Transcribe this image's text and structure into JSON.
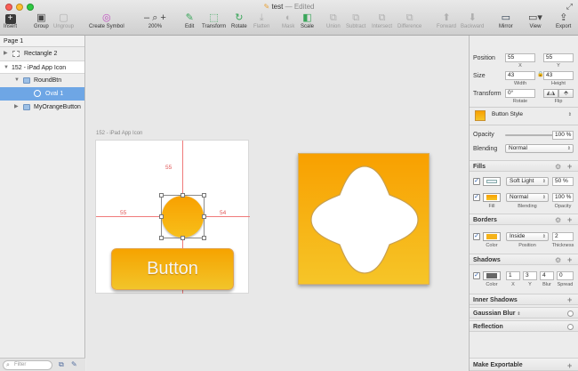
{
  "window": {
    "title": "test",
    "title_sep": "—",
    "title_status": "Edited",
    "fullscreen_icon": "fullscreen-icon"
  },
  "toolbar": {
    "insert": "Insert",
    "group": "Group",
    "ungroup": "Ungroup",
    "create_symbol": "Create Symbol",
    "zoom": "200%",
    "zoom_minus": "–",
    "zoom_plus": "+",
    "edit": "Edit",
    "transform": "Transform",
    "rotate": "Rotate",
    "flatten": "Flatten",
    "mask": "Mask",
    "scale": "Scale",
    "union": "Union",
    "subtract": "Subtract",
    "intersect": "Intersect",
    "difference": "Difference",
    "forward": "Forward",
    "backward": "Backward",
    "mirror": "Mirror",
    "view": "View",
    "export": "Export"
  },
  "layers": {
    "page": "Page 1",
    "items": [
      {
        "label": "Rectangle 2"
      },
      {
        "label": "152 - iPad App Icon"
      },
      {
        "label": "RoundBtn"
      },
      {
        "label": "Oval 1"
      },
      {
        "label": "MyOrangeButton"
      }
    ],
    "filter_placeholder": "Filter"
  },
  "canvas": {
    "artboard_label": "152 - iPad App Icon",
    "dist_top": "55",
    "dist_left": "55",
    "dist_right": "54",
    "button_text": "Button"
  },
  "inspector": {
    "position_label": "Position",
    "position_x": "55",
    "position_y": "55",
    "x_label": "X",
    "y_label": "Y",
    "size_label": "Size",
    "width": "43",
    "height": "43",
    "width_label": "Width",
    "height_label": "Height",
    "transform_label": "Transform",
    "rotate_value": "0°",
    "rotate_label": "Rotate",
    "flip_label": "Flip",
    "style_name": "Button Style",
    "opacity_label": "Opacity",
    "opacity_value": "100 %",
    "blending_label": "Blending",
    "blending_value": "Normal",
    "fills_title": "Fills",
    "fills": [
      {
        "blend": "Soft Light",
        "opacity": "50 %"
      },
      {
        "blend": "Normal",
        "opacity": "100 %"
      }
    ],
    "fill_label": "Fill",
    "fill_blend_label": "Blending",
    "fill_opacity_label": "Opacity",
    "borders_title": "Borders",
    "border_position": "Inside",
    "border_thickness": "2",
    "border_color_label": "Color",
    "border_position_label": "Position",
    "border_thickness_label": "Thickness",
    "shadows_title": "Shadows",
    "shadow_x": "1",
    "shadow_y": "3",
    "shadow_blur": "4",
    "shadow_spread": "0",
    "shadow_color_label": "Color",
    "shadow_x_label": "X",
    "shadow_y_label": "Y",
    "shadow_blur_label": "Blur",
    "shadow_spread_label": "Spread",
    "inner_shadows_title": "Inner Shadows",
    "gaussian_blur_title": "Gaussian Blur",
    "reflection_title": "Reflection",
    "make_exportable": "Make Exportable"
  },
  "colors": {
    "accent": "#6ea6e5",
    "orange": "#f8a000",
    "orange_light": "#f6c528",
    "guide": "#f07a7a"
  }
}
